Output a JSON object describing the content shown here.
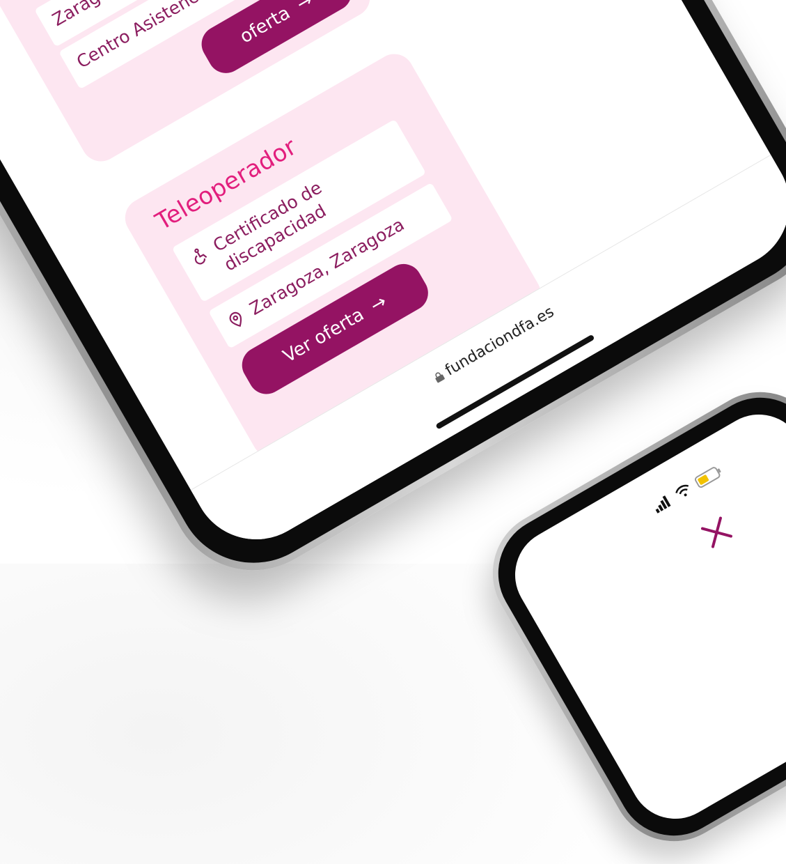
{
  "listing": {
    "title": "Teleoperador",
    "certificate": "Certificado de discapacidad",
    "location": "Zaragoza, Zaragoza",
    "button_label": "Ver oferta",
    "button_arrow": "→"
  },
  "previous_listing": {
    "location": "Zaragoza",
    "center": "Centro Asistencial",
    "button_label": "oferta",
    "button_arrow": "→"
  },
  "browser": {
    "url": "fundaciondfa.es",
    "lock_icon": "lock-icon"
  },
  "second_phone": {
    "close_icon": "close-icon"
  },
  "colors": {
    "accent": "#e21e7d",
    "button": "#941363",
    "card": "#fde6f1",
    "text": "#8b1d5f"
  }
}
